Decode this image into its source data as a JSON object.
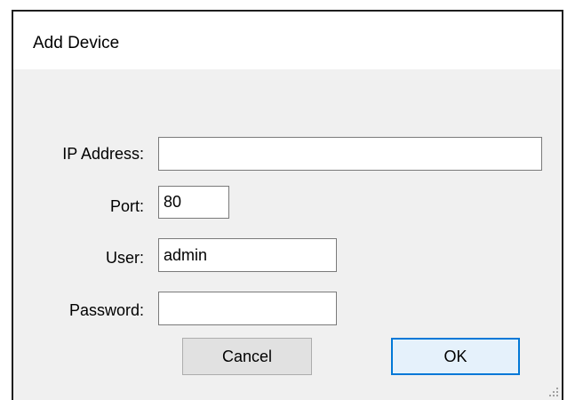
{
  "dialog": {
    "title": "Add Device"
  },
  "form": {
    "ip_label": "IP Address:",
    "ip_value": "",
    "port_label": "Port:",
    "port_value": "80",
    "user_label": "User:",
    "user_value": "admin",
    "password_label": "Password:",
    "password_value": ""
  },
  "buttons": {
    "cancel_label": "Cancel",
    "ok_label": "OK"
  }
}
